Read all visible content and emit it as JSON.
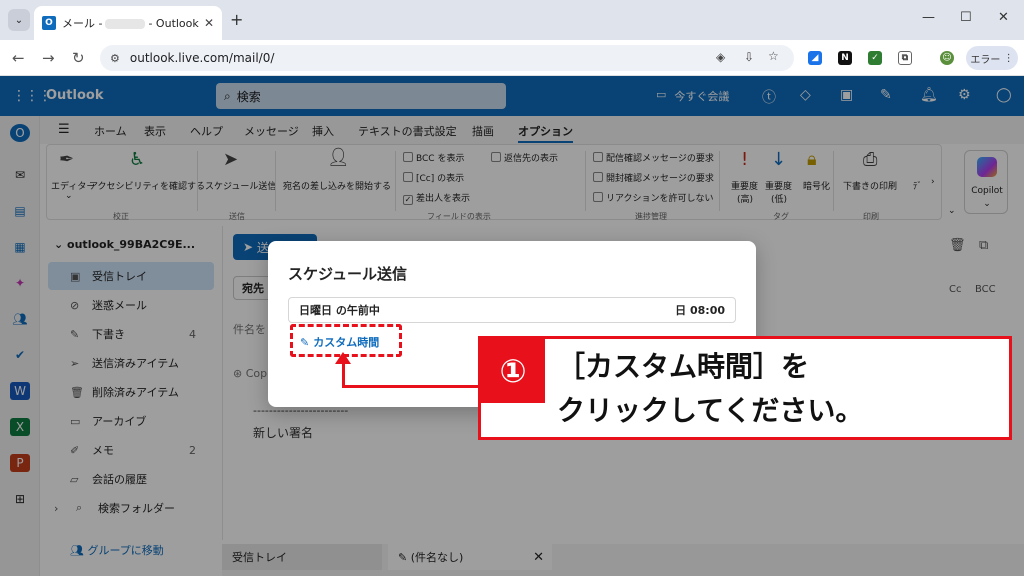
{
  "browser": {
    "tab_title_prefix": "メール -",
    "tab_title_suffix": "- Outlook",
    "url": "outlook.live.com/mail/0/",
    "profile_label": "エラー",
    "ext_n": "N"
  },
  "header": {
    "brand": "Outlook",
    "search_placeholder": "検索",
    "meet_now": "今すぐ会議"
  },
  "ribbon": {
    "tabs": [
      "ホーム",
      "表示",
      "ヘルプ",
      "メッセージ",
      "挿入",
      "テキストの書式設定",
      "描画",
      "オプション"
    ],
    "active_tab": "オプション",
    "editor": "エディター",
    "accessibility": "アクセシビリティを確認する",
    "schedule_send": "スケジュール送信",
    "mail_merge": "宛名の差し込みを開始する",
    "bcc": "BCC を表示",
    "cc": "[Cc] の表示",
    "from": "差出人を表示",
    "reply_to": "返信先の表示",
    "delivery_receipt": "配信確認メッセージの要求",
    "read_receipt": "開封確認メッセージの要求",
    "disallow_reactions": "リアクションを許可しない",
    "importance_high": "重要度",
    "importance_high_sub": "(高)",
    "importance_low": "重要度",
    "importance_low_sub": "(低)",
    "encrypt": "暗号化",
    "print_draft": "下書きの印刷",
    "more": "ﾃﾞ",
    "group_proofing": "校正",
    "group_send": "送信",
    "group_fields": "フィールドの表示",
    "group_tracking": "進捗管理",
    "group_tags": "タグ",
    "group_print": "印刷",
    "copilot": "Copilot"
  },
  "folders": {
    "account": "outlook_99BA2C9E...",
    "items": [
      {
        "label": "受信トレイ",
        "count": ""
      },
      {
        "label": "迷惑メール",
        "count": ""
      },
      {
        "label": "下書き",
        "count": "4"
      },
      {
        "label": "送信済みアイテム",
        "count": ""
      },
      {
        "label": "削除済みアイテム",
        "count": ""
      },
      {
        "label": "アーカイブ",
        "count": ""
      },
      {
        "label": "メモ",
        "count": "2"
      },
      {
        "label": "会話の履歴",
        "count": ""
      },
      {
        "label": "検索フォルダー",
        "count": ""
      }
    ],
    "goto_groups": "グループに移動"
  },
  "compose": {
    "send": "送",
    "to": "宛先",
    "cc": "Cc",
    "bcc": "BCC",
    "subject_placeholder": "件名を",
    "copilot_hint": "Cop",
    "divider": "------------------------",
    "signature": "新しい署名"
  },
  "bottom_tabs": {
    "inbox": "受信トレイ",
    "draft": "(件名なし)"
  },
  "dialog": {
    "title": "スケジュール送信",
    "option_label": "日曜日 の午前中",
    "option_time": "日 08:00",
    "custom_time": "カスタム時間"
  },
  "annotation": {
    "number": "①",
    "line1": "［カスタム時間］を",
    "line2": "クリックしてください。",
    "color": "#e8101a"
  }
}
